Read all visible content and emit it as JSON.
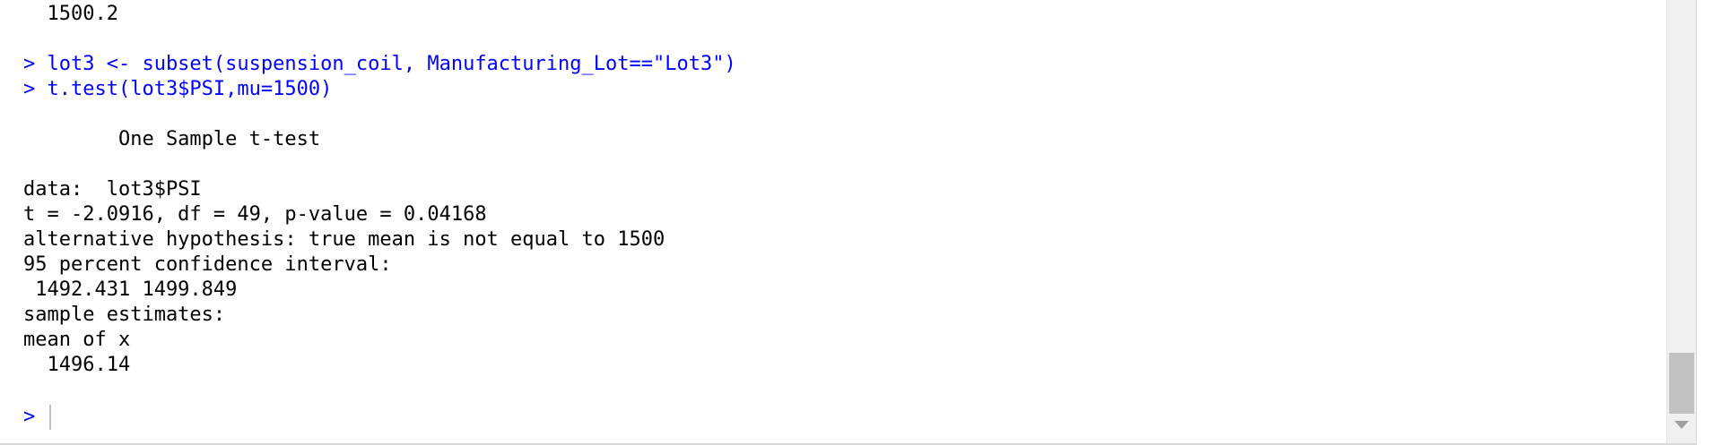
{
  "console": {
    "lines": [
      {
        "text": "  1500.2",
        "kind": "output"
      },
      {
        "text": "",
        "kind": "blank"
      },
      {
        "text": "> lot3 <- subset(suspension_coil, Manufacturing_Lot==\"Lot3\")",
        "kind": "command"
      },
      {
        "text": "> t.test(lot3$PSI,mu=1500)",
        "kind": "command"
      },
      {
        "text": "",
        "kind": "blank"
      },
      {
        "text": "        One Sample t-test",
        "kind": "output"
      },
      {
        "text": "",
        "kind": "blank"
      },
      {
        "text": "data:  lot3$PSI",
        "kind": "output"
      },
      {
        "text": "t = -2.0916, df = 49, p-value = 0.04168",
        "kind": "output"
      },
      {
        "text": "alternative hypothesis: true mean is not equal to 1500",
        "kind": "output"
      },
      {
        "text": "95 percent confidence interval:",
        "kind": "output"
      },
      {
        "text": " 1492.431 1499.849",
        "kind": "output"
      },
      {
        "text": "sample estimates:",
        "kind": "output"
      },
      {
        "text": "mean of x",
        "kind": "output"
      },
      {
        "text": "  1496.14",
        "kind": "output"
      },
      {
        "text": "",
        "kind": "blank"
      },
      {
        "text": "> ",
        "kind": "prompt"
      }
    ]
  },
  "colors": {
    "command": "#0000ff",
    "output": "#000000",
    "background": "#ffffff"
  }
}
